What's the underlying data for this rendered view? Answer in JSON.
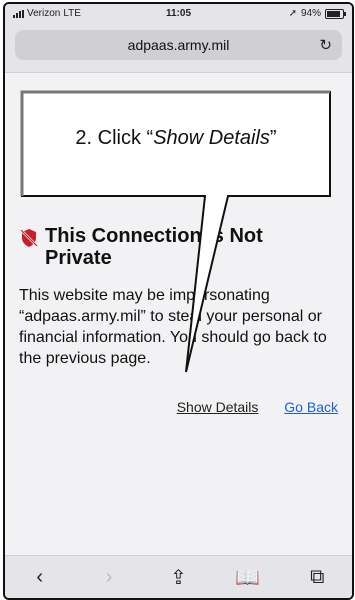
{
  "status": {
    "carrier": "Verizon",
    "network": "LTE",
    "time": "11:05",
    "battery": "94%"
  },
  "address_bar": {
    "url": "adpaas.army.mil",
    "reload_icon": "reload-icon"
  },
  "warning": {
    "title_line1": "This Connection Is Not",
    "title_line2": "Private",
    "body": "This website may be impersonating “adpaas.army.mil” to steal your personal or financial information. You should go back to the previous page.",
    "show_details": "Show Details",
    "go_back": "Go Back"
  },
  "callout": {
    "prefix": "2. Click “",
    "emph": "Show Details",
    "suffix": "”"
  },
  "toolbar": {
    "back": "back-icon",
    "forward": "forward-icon",
    "share": "share-icon",
    "bookmarks": "bookmarks-icon",
    "tabs": "tabs-icon"
  },
  "colors": {
    "link": "#1a5fe0",
    "warning_icon": "#c8202a"
  }
}
